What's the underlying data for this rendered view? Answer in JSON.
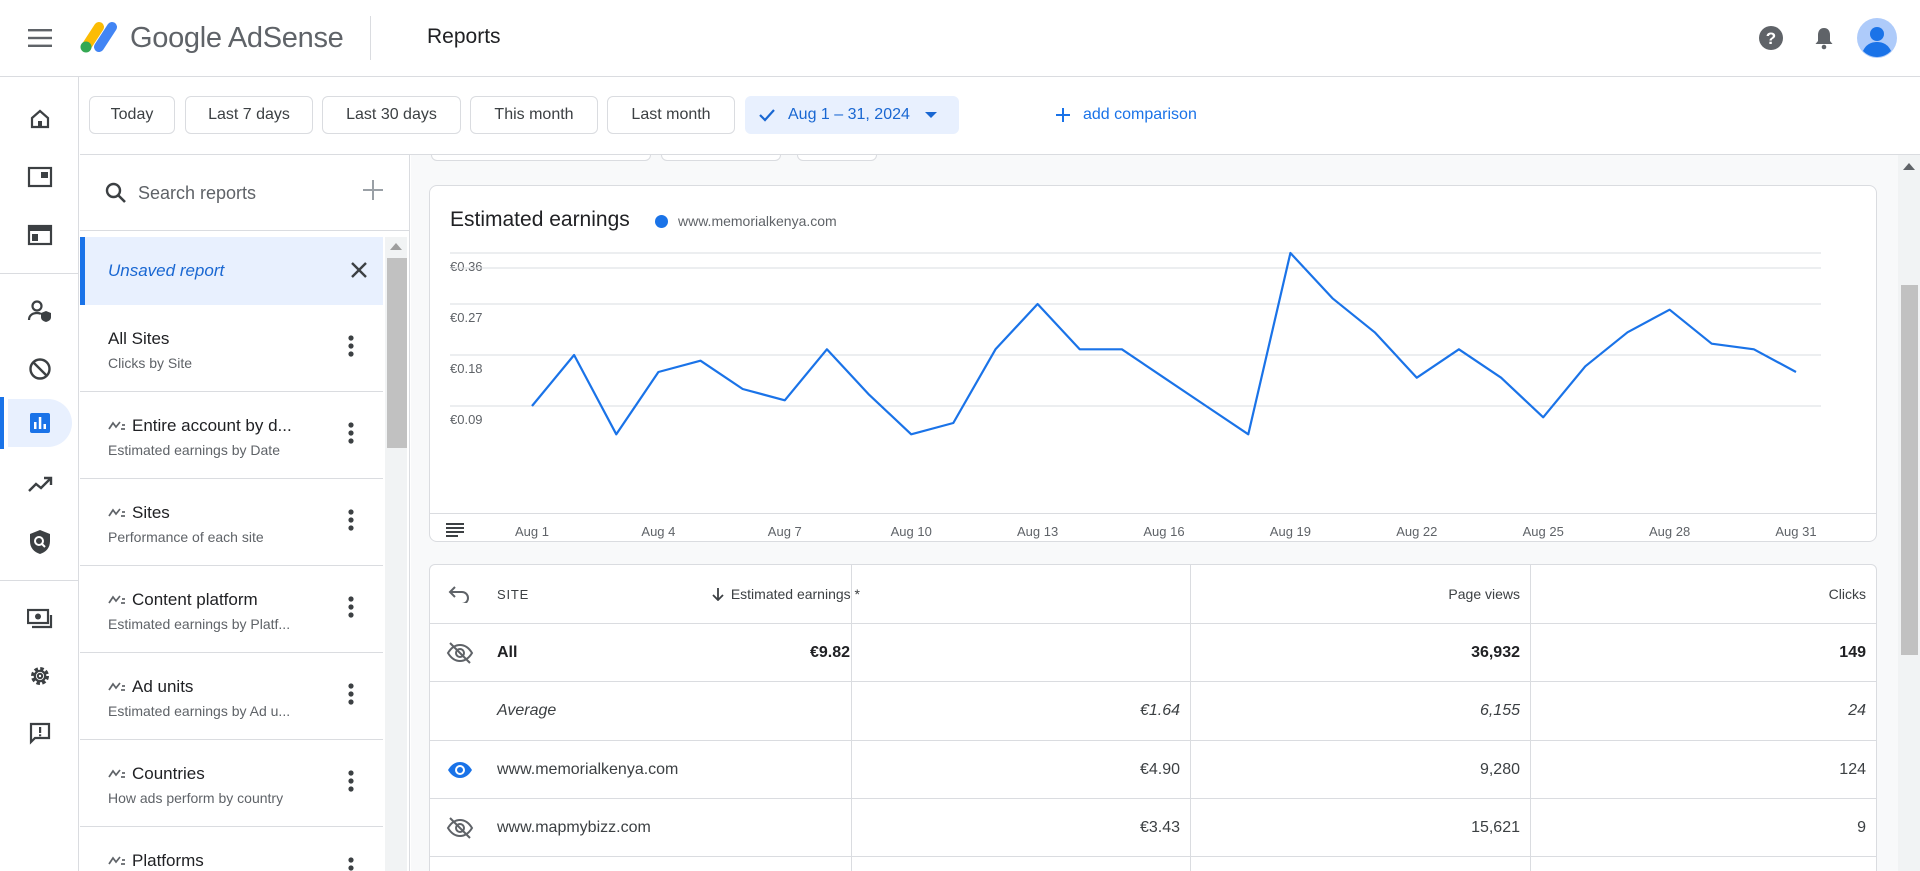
{
  "app": {
    "name_google": "Google",
    "name_product": "AdSense",
    "page_title": "Reports"
  },
  "date_ranges": [
    "Today",
    "Last 7 days",
    "Last 30 days",
    "This month",
    "Last month"
  ],
  "selected_range": "Aug 1 – 31, 2024",
  "add_comparison": "add comparison",
  "search": {
    "placeholder": "Search reports"
  },
  "reports": {
    "unsaved": "Unsaved report",
    "items": [
      {
        "title": "All Sites",
        "subtitle": "Clicks by Site",
        "icon": ""
      },
      {
        "title": "Entire account by d...",
        "subtitle": "Estimated earnings by Date",
        "icon": "sparkline-icon"
      },
      {
        "title": "Sites",
        "subtitle": "Performance of each site",
        "icon": "sparkline-icon"
      },
      {
        "title": "Content platform",
        "subtitle": "Estimated earnings by Platf...",
        "icon": "sparkline-icon"
      },
      {
        "title": "Ad units",
        "subtitle": "Estimated earnings by Ad u...",
        "icon": "sparkline-icon"
      },
      {
        "title": "Countries",
        "subtitle": "How ads perform by country",
        "icon": "sparkline-icon"
      },
      {
        "title": "Platforms",
        "subtitle": "",
        "icon": "sparkline-icon"
      }
    ]
  },
  "chart_data": {
    "type": "line",
    "title": "Estimated earnings",
    "series": [
      {
        "name": "www.memorialkenya.com",
        "x": [
          "Aug 1",
          "Aug 2",
          "Aug 3",
          "Aug 4",
          "Aug 5",
          "Aug 6",
          "Aug 7",
          "Aug 8",
          "Aug 9",
          "Aug 10",
          "Aug 11",
          "Aug 12",
          "Aug 13",
          "Aug 14",
          "Aug 15",
          "Aug 16",
          "Aug 17",
          "Aug 18",
          "Aug 19",
          "Aug 20",
          "Aug 21",
          "Aug 22",
          "Aug 23",
          "Aug 24",
          "Aug 25",
          "Aug 26",
          "Aug 27",
          "Aug 28",
          "Aug 29",
          "Aug 30",
          "Aug 31"
        ],
        "values": [
          0.09,
          0.18,
          0.04,
          0.15,
          0.17,
          0.12,
          0.1,
          0.19,
          0.11,
          0.04,
          0.06,
          0.19,
          0.27,
          0.19,
          0.19,
          0.14,
          0.09,
          0.04,
          0.36,
          0.28,
          0.22,
          0.14,
          0.19,
          0.14,
          0.07,
          0.16,
          0.22,
          0.26,
          0.2,
          0.19,
          0.15
        ]
      }
    ],
    "x_ticks": [
      "Aug 1",
      "Aug 4",
      "Aug 7",
      "Aug 10",
      "Aug 13",
      "Aug 16",
      "Aug 19",
      "Aug 22",
      "Aug 25",
      "Aug 28",
      "Aug 31"
    ],
    "y_ticks": [
      "€0.09",
      "€0.18",
      "€0.27",
      "€0.36"
    ],
    "ylim": [
      0,
      0.36
    ],
    "color": "#1a73e8",
    "grid": true
  },
  "table": {
    "headers": {
      "site": "SITE",
      "earnings": "Estimated earnings *",
      "pageviews": "Page views",
      "clicks": "Clicks"
    },
    "total": {
      "label": "All",
      "earnings": "€9.82",
      "pageviews": "36,932",
      "clicks": "149"
    },
    "average": {
      "label": "Average",
      "earnings": "€1.64",
      "pageviews": "6,155",
      "clicks": "24"
    },
    "rows": [
      {
        "site": "www.memorialkenya.com",
        "earnings": "€4.90",
        "pageviews": "9,280",
        "clicks": "124",
        "visible": true
      },
      {
        "site": "www.mapmybizz.com",
        "earnings": "€3.43",
        "pageviews": "15,621",
        "clicks": "9",
        "visible": false
      }
    ]
  }
}
